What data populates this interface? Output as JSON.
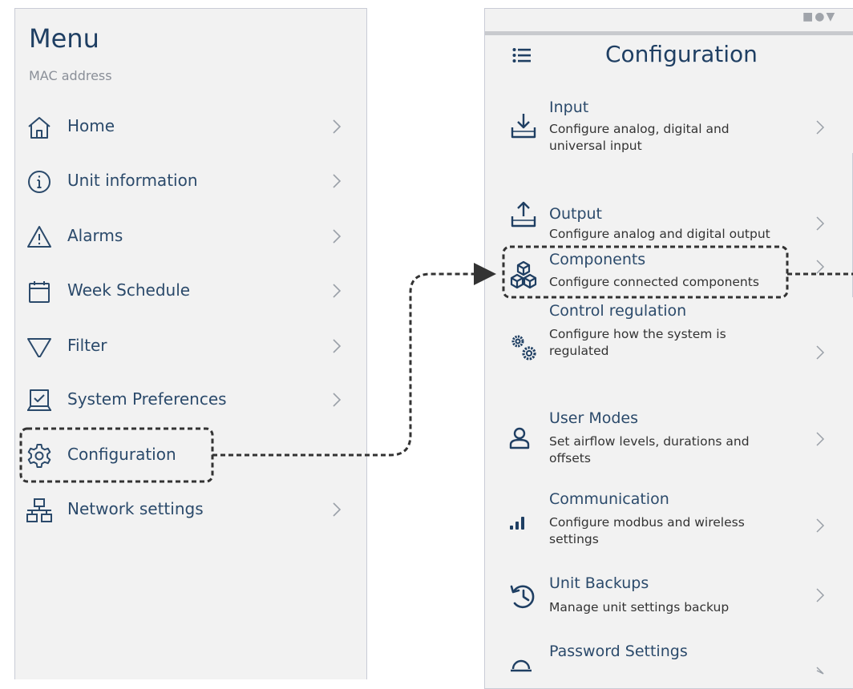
{
  "menu": {
    "title": "Menu",
    "subtitle": "MAC address",
    "items": [
      {
        "label": "Home",
        "icon": "home-icon"
      },
      {
        "label": "Unit information",
        "icon": "info-icon"
      },
      {
        "label": "Alarms",
        "icon": "warning-icon"
      },
      {
        "label": "Week Schedule",
        "icon": "calendar-icon"
      },
      {
        "label": "Filter",
        "icon": "filter-icon"
      },
      {
        "label": "System Preferences",
        "icon": "preferences-icon"
      },
      {
        "label": "Configuration",
        "icon": "gear-icon"
      },
      {
        "label": "Network settings",
        "icon": "network-icon"
      }
    ]
  },
  "configuration": {
    "title": "Configuration",
    "status_icons": "■●▼",
    "items": [
      {
        "title": "Input",
        "description": "Configure analog, digital and universal input",
        "icon": "input-download-icon"
      },
      {
        "title": "Output",
        "description": "Configure analog and digital output",
        "icon": "output-upload-icon"
      },
      {
        "title": "Components",
        "description": "Configure connected components",
        "icon": "components-cubes-icon"
      },
      {
        "title": "Control regulation",
        "description": "Configure how the system is regulated",
        "icon": "control-gears-icon"
      },
      {
        "title": "User Modes",
        "description": "Set airflow levels, durations and offsets",
        "icon": "user-icon"
      },
      {
        "title": "Communication",
        "description": "Configure modbus and wireless settings",
        "icon": "signal-bars-icon"
      },
      {
        "title": "Unit Backups",
        "description": "Manage unit settings backup",
        "icon": "backup-history-icon"
      },
      {
        "title": "Password Settings",
        "description": "",
        "icon": "password-icon"
      }
    ]
  },
  "colors": {
    "accent": "#2b4a6b",
    "panel": "#f2f2f2",
    "border": "#c9ccd6",
    "dash": "#333333"
  }
}
